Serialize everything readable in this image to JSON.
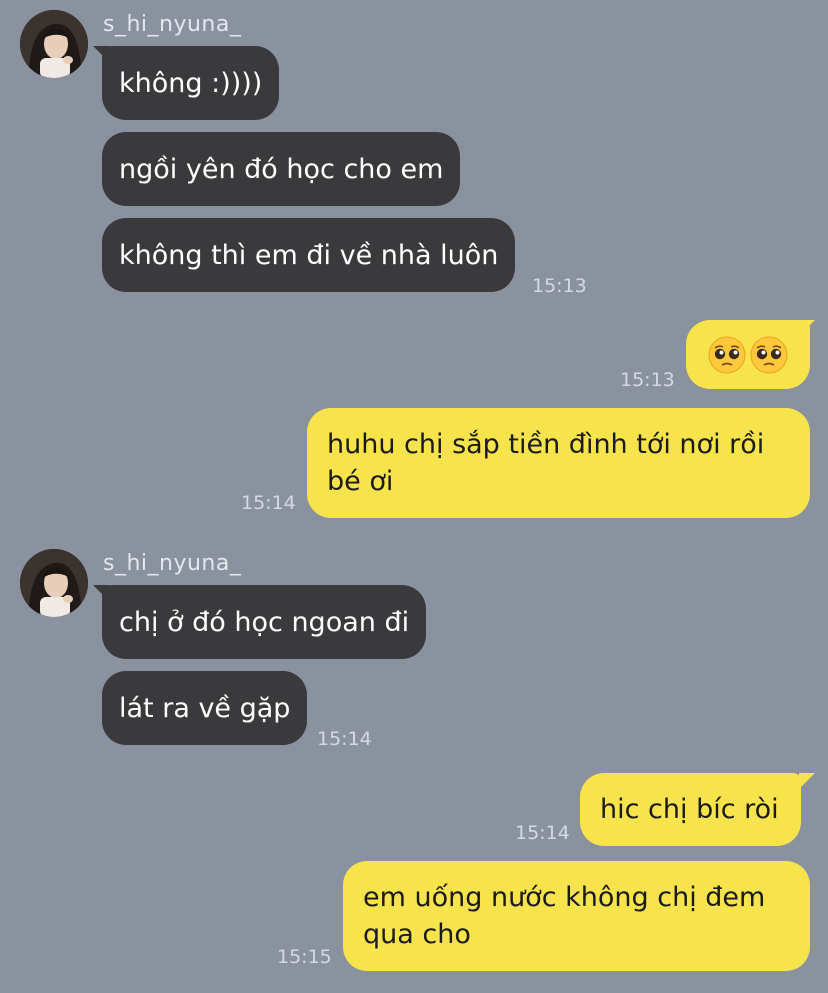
{
  "chat": {
    "groups": [
      {
        "sender": "s_hi_nyuna_",
        "messages": [
          "không :))))",
          "ngồi yên đó học cho em",
          "không thì em đi về nhà luôn"
        ],
        "time": "15:13"
      },
      {
        "sender": "s_hi_nyuna_",
        "messages": [
          "chị ở đó học ngoan đi",
          "lát ra về gặp"
        ],
        "time": "15:14"
      }
    ],
    "outgoing": [
      {
        "emoji": [
          "pleading-face-icon",
          "pleading-face-icon"
        ],
        "time": "15:13"
      },
      {
        "lines": [
          "huhu chị sắp tiền đình tới nơi rồi",
          "bé ơi"
        ],
        "time": "15:14"
      },
      {
        "text": "hic chị bíc ròi",
        "time": "15:14"
      },
      {
        "lines": [
          "em uống nước không chị đem",
          "qua cho"
        ],
        "time": "15:15"
      }
    ]
  },
  "colors": {
    "background": "#8a92a0",
    "incoming_bubble": "#3a3a3c",
    "outgoing_bubble": "#f7e34b"
  }
}
